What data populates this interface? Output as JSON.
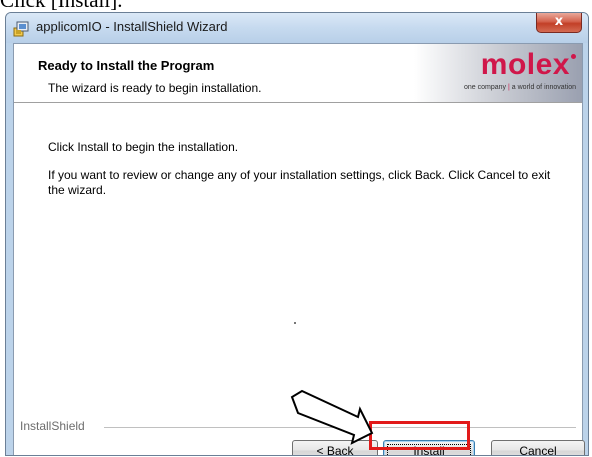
{
  "caption": "Click [Install].",
  "window": {
    "title": "applicomIO - InstallShield Wizard",
    "close_symbol": "x"
  },
  "banner": {
    "title": "Ready to Install the Program",
    "subtitle": "The wizard is ready to begin installation.",
    "logo_word": "molex",
    "logo_tagline_left": "one company",
    "logo_tagline_right": "a world of innovation"
  },
  "content": {
    "line1": "Click Install to begin the installation.",
    "line2": "If you want to review or change any of your installation settings, click Back. Click Cancel to exit the wizard."
  },
  "footer": {
    "brand": "InstallShield"
  },
  "buttons": {
    "back": "< Back",
    "install": "Install",
    "cancel": "Cancel"
  },
  "colors": {
    "highlight": "#e21a1a",
    "brand": "#d0174a"
  },
  "icons": {
    "app": "installer-package-icon",
    "pointer": "arrow-pointer-icon"
  }
}
